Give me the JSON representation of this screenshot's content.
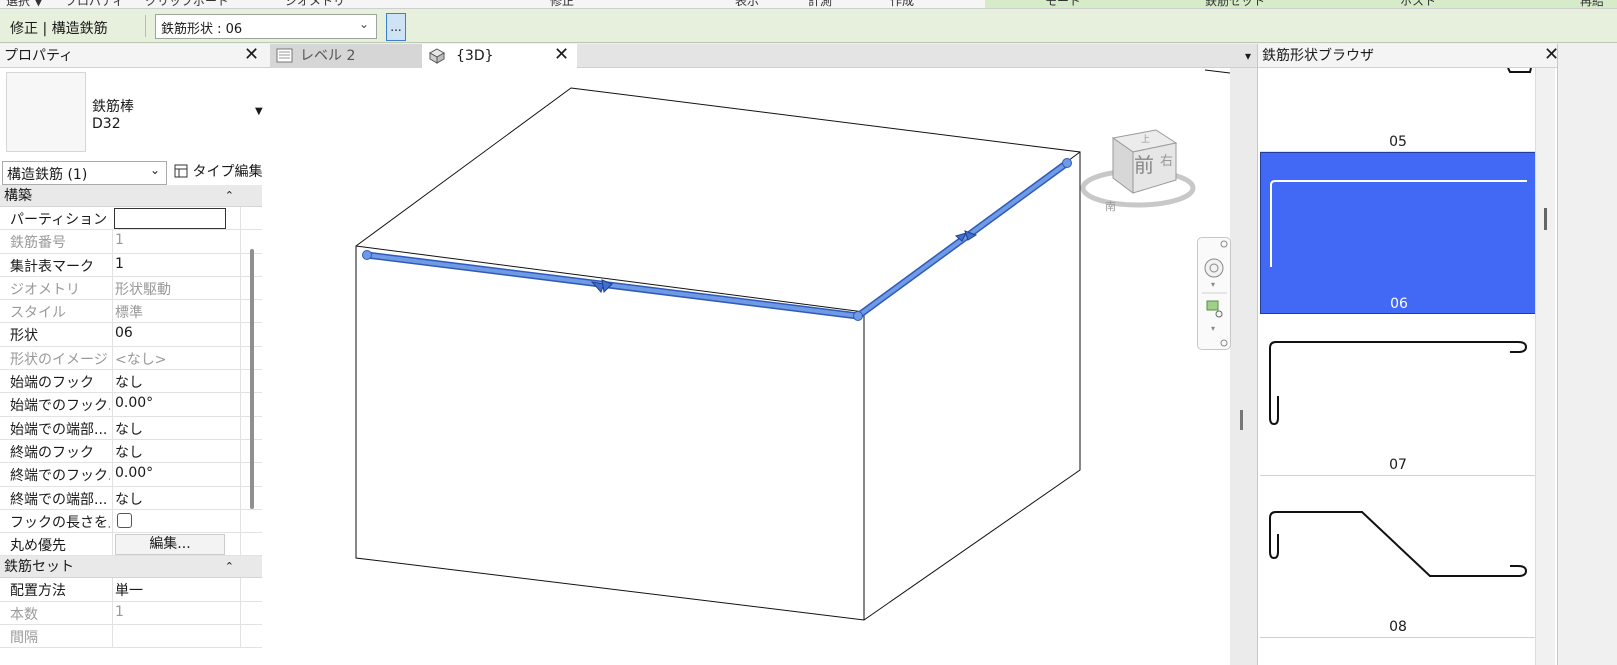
{
  "ribbon": {
    "tabs": [
      "選択 ▼",
      "プロパティ",
      "クリップボード",
      "ジオメトリ",
      "修正",
      "表示",
      "計測",
      "作成",
      "モード",
      "鉄筋セット",
      "ホスト",
      "再結"
    ]
  },
  "options_bar": {
    "context_label": "修正 | 構造鉄筋",
    "shape_select": "鉄筋形状 : 06",
    "browse_button": "..."
  },
  "properties": {
    "title": "プロパティ",
    "type_family": "鉄筋棒",
    "type_name": "D32",
    "instance_filter": "構造鉄筋 (1)",
    "edit_type_label": "タイプ編集",
    "groups": [
      {
        "name": "構築",
        "rows": [
          {
            "name": "パーティション",
            "value": ""
          },
          {
            "name": "鉄筋番号",
            "value": "1"
          },
          {
            "name": "集計表マーク",
            "value": "1"
          },
          {
            "name": "ジオメトリ",
            "value": "形状駆動"
          },
          {
            "name": "スタイル",
            "value": "標準"
          },
          {
            "name": "形状",
            "value": "06"
          },
          {
            "name": "形状のイメージ",
            "value": "<なし>"
          },
          {
            "name": "始端のフック",
            "value": "なし"
          },
          {
            "name": "始端でのフック...",
            "value": "0.00°"
          },
          {
            "name": "始端での端部...",
            "value": "なし"
          },
          {
            "name": "終端のフック",
            "value": "なし"
          },
          {
            "name": "終端でのフック...",
            "value": "0.00°"
          },
          {
            "name": "終端での端部...",
            "value": "なし"
          },
          {
            "name": "フックの長さを上...",
            "value": ""
          },
          {
            "name": "丸め優先",
            "value": "編集..."
          }
        ]
      },
      {
        "name": "鉄筋セット",
        "rows": [
          {
            "name": "配置方法",
            "value": "単一"
          },
          {
            "name": "本数",
            "value": "1"
          },
          {
            "name": "間隔",
            "value": ""
          }
        ]
      }
    ]
  },
  "view": {
    "tabs": [
      {
        "label": "レベル 2",
        "active": false
      },
      {
        "label": "{3D}",
        "active": true
      }
    ],
    "viewcube_face": "前",
    "viewcube_side": "右",
    "viewcube_top": "上",
    "viewcube_compass": "南"
  },
  "shape_browser": {
    "title": "鉄筋形状ブラウザ",
    "items": [
      {
        "label": "05"
      },
      {
        "label": "06",
        "selected": true
      },
      {
        "label": "07"
      },
      {
        "label": "08"
      }
    ]
  },
  "colors": {
    "selection_blue": "#4169f5",
    "rebar_blue": "#4f82d6",
    "options_bar_bg": "#e6f0dc"
  }
}
